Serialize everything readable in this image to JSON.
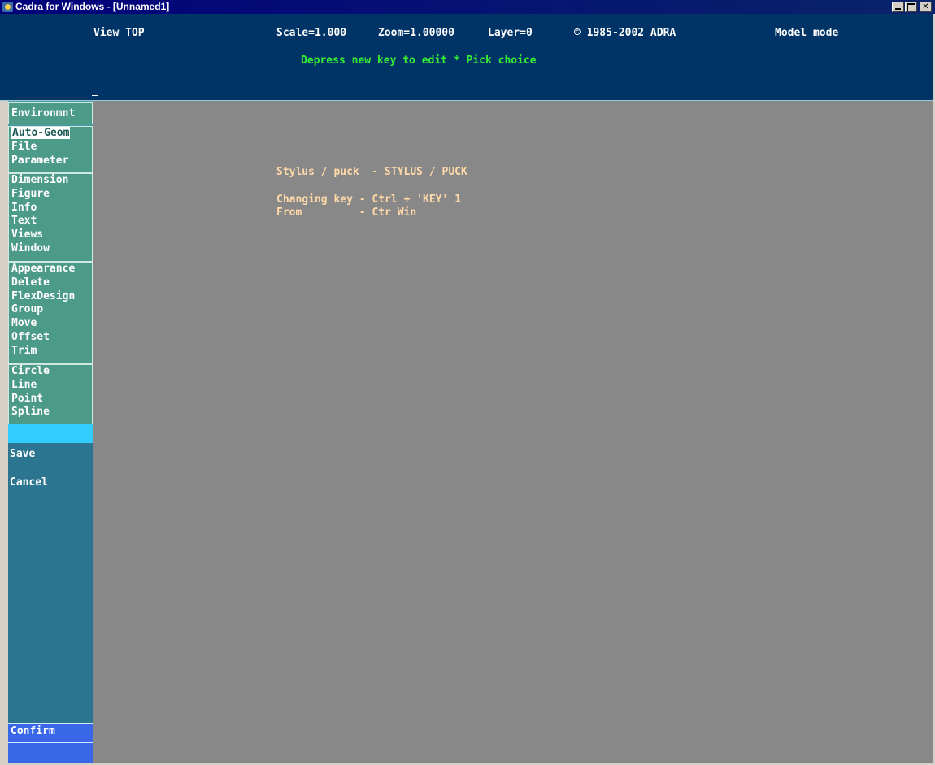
{
  "window": {
    "title": "Cadra for Windows - [Unnamed1]",
    "icon": "cadra-app-icon",
    "controls": [
      "minimize",
      "maximize",
      "close"
    ]
  },
  "header": {
    "view": "View TOP",
    "scale": "Scale=1.000",
    "zoom": "Zoom=1.00000",
    "layer": "Layer=0",
    "copyright": "© 1985-2002 ADRA",
    "mode": "Model mode",
    "prompt": "Depress new key to edit * Pick choice"
  },
  "menu": {
    "group1": [
      "Environmnt"
    ],
    "group2": [
      "Auto-Geom",
      "File",
      "Parameter"
    ],
    "group3": [
      "Dimension",
      "Figure",
      "Info",
      "Text",
      "Views",
      "Window"
    ],
    "group4": [
      "Appearance",
      "Delete",
      "FlexDesign",
      "Group",
      "Move",
      "Offset",
      "Trim"
    ],
    "group5": [
      "Circle",
      "Line",
      "Point",
      "Spline"
    ],
    "selected": "Auto-Geom",
    "save": "Save",
    "cancel": "Cancel",
    "confirm": "Confirm"
  },
  "canvas": {
    "line1": "Stylus / puck  - STYLUS / PUCK",
    "line2": "Changing key - Ctrl + 'KEY' 1",
    "line3": "From         - Ctr Win"
  },
  "colors": {
    "header_bg": "#003366",
    "prompt": "#33ee33",
    "menu_bg": "#4c9a88",
    "canvas_bg": "#888888",
    "canvas_text": "#ffd9a8",
    "confirm_bg": "#3a67e8"
  }
}
